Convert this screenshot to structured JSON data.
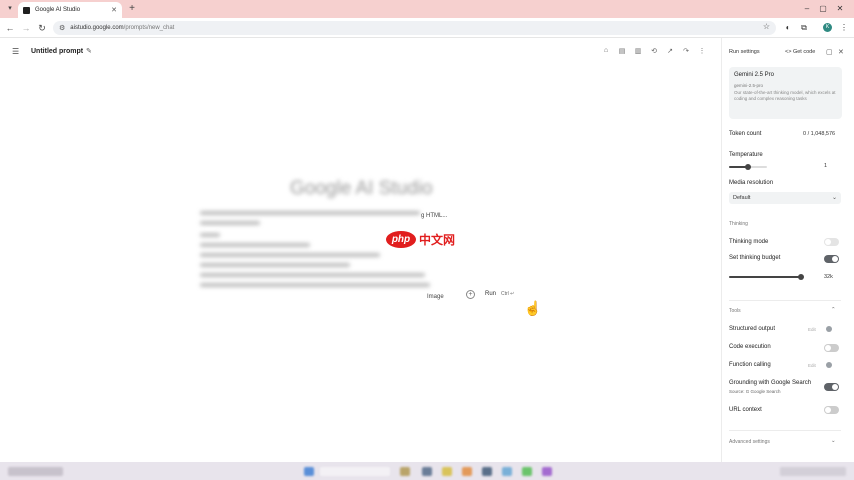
{
  "browser": {
    "tab_title": "Google AI Studio",
    "url_host": "aistudio.google.com",
    "url_path": "/prompts/new_chat",
    "profile_initial": "K"
  },
  "header": {
    "prompt_title": "Untitled prompt"
  },
  "main": {
    "intro_title": "Google AI Studio",
    "frag_html": "g HTML...",
    "frag_image": "Image",
    "run_label": "Run",
    "run_shortcut": "Ctrl ↵"
  },
  "watermark": {
    "php": "php",
    "cn": "中文网"
  },
  "panel": {
    "title": "Run settings",
    "get_code": "<> Get code",
    "model": {
      "name": "Gemini 2.5 Pro",
      "id": "gemini-2.5-pro",
      "description": "Our state-of-the-art thinking model, which excels at coding and complex reasoning tasks"
    },
    "token_count_label": "Token count",
    "token_count_value": "0 / 1,048,576",
    "temperature_label": "Temperature",
    "temperature_value": "1",
    "temperature_fraction": 0.5,
    "media_resolution_label": "Media resolution",
    "media_resolution_value": "Default",
    "thinking_section": "Thinking",
    "thinking_mode_label": "Thinking mode",
    "thinking_budget_label": "Set thinking budget",
    "thinking_budget_value": "32k",
    "thinking_budget_fraction": 0.97,
    "tools_section": "Tools",
    "structured_output_label": "Structured output",
    "code_execution_label": "Code execution",
    "function_calling_label": "Function calling",
    "edit_label": "Edit",
    "grounding_label": "Grounding with Google Search",
    "grounding_source": "Source: G Google Search",
    "url_context_label": "URL context",
    "advanced_label": "Advanced settings"
  },
  "colors": {
    "tabstrip": "#f6d0cf",
    "toggle_on": "#5f6368",
    "watermark_red": "#e11e1e"
  }
}
